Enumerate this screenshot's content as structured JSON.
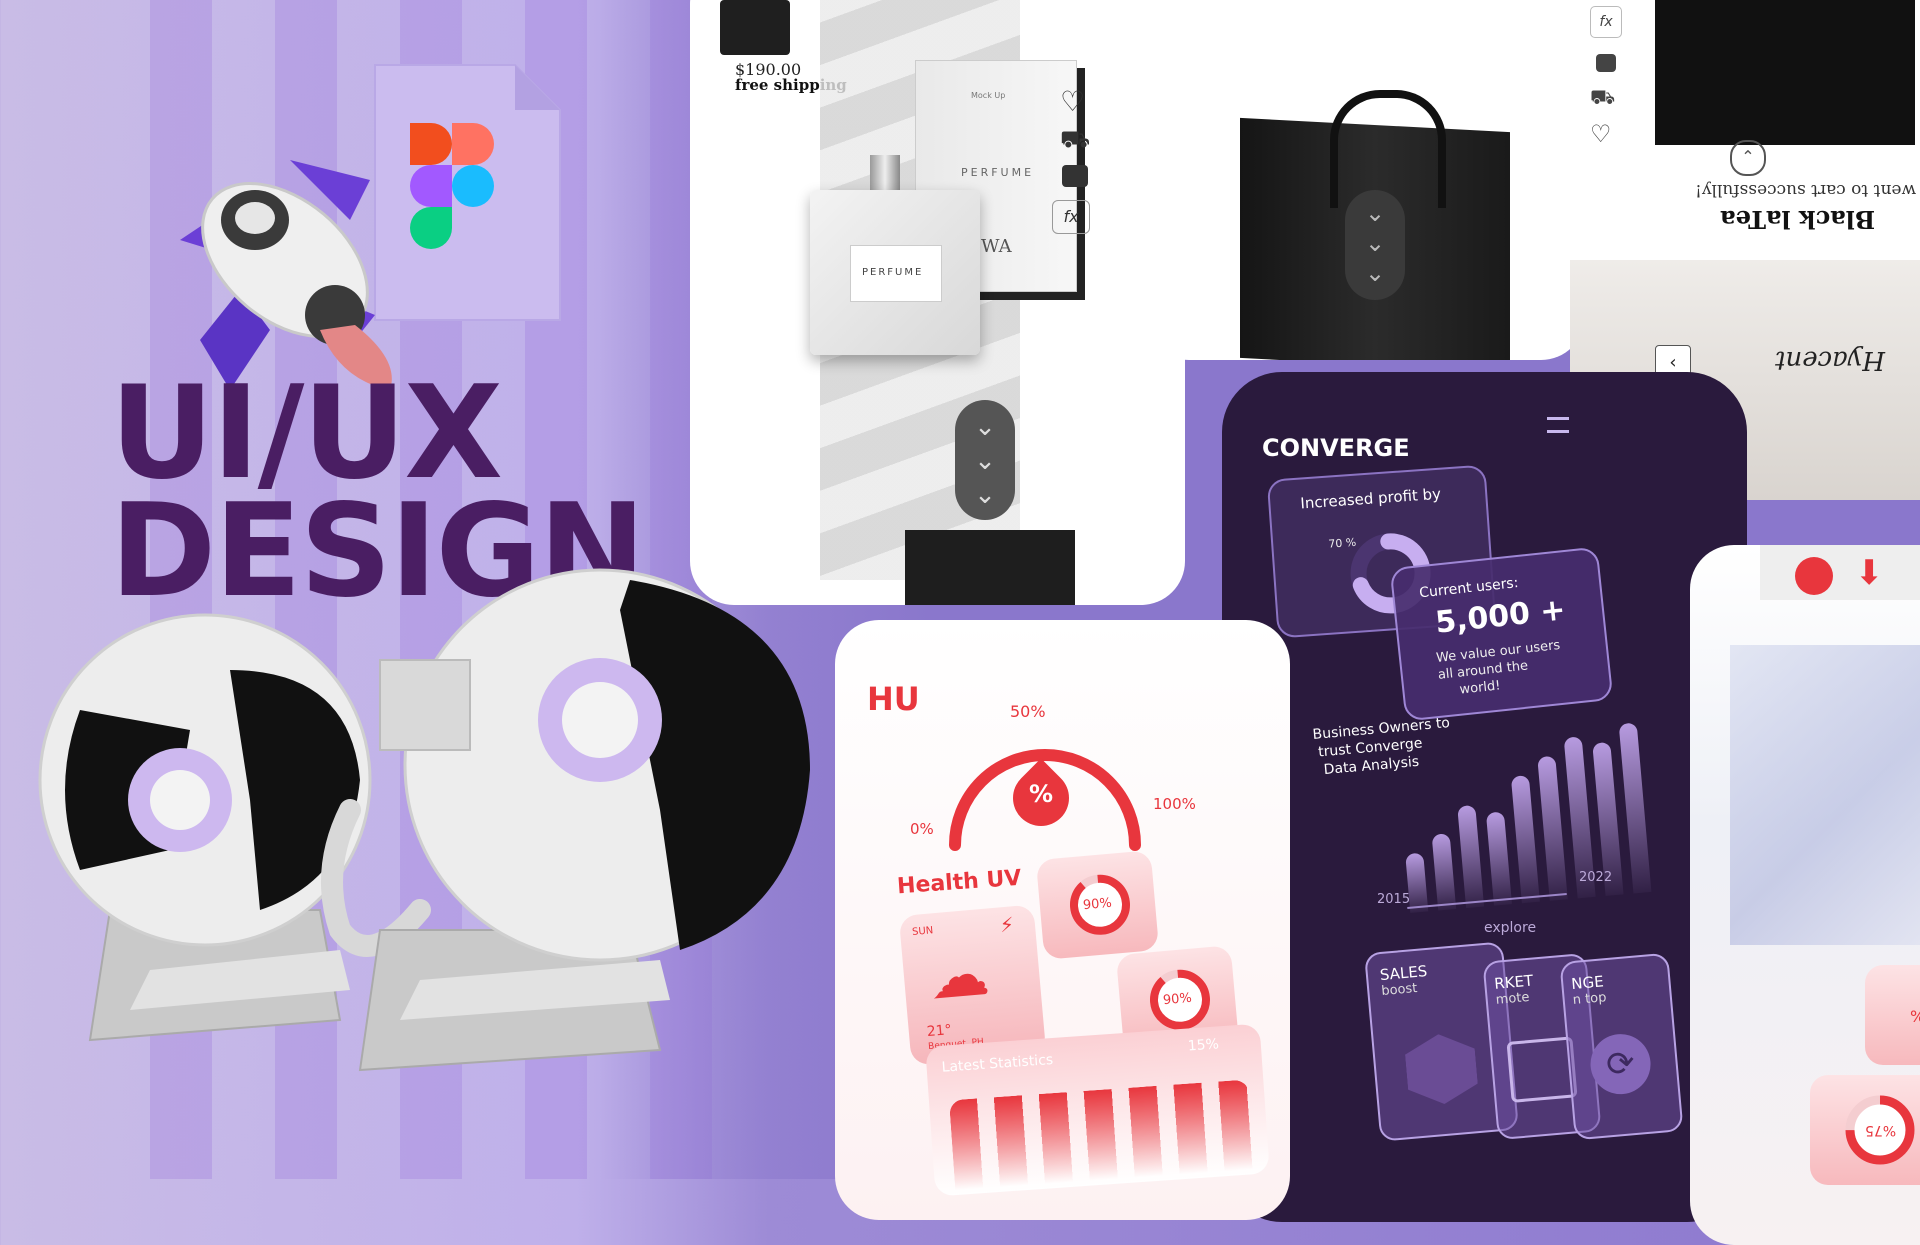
{
  "hero": {
    "title_line1": "UI/UX",
    "title_line2": "DESIGN",
    "title_color": "#4a1e63"
  },
  "perfume_card": {
    "price": "$190.00",
    "shipping": "free shipping",
    "box_label": "PERFUME",
    "bottle_label": "PERFUME",
    "box_brand": "WA",
    "mockup_label": "Mock Up"
  },
  "cart_card": {
    "message": "went to cart successfully!",
    "product_name": "Black laTea",
    "script_word": "Hyacent"
  },
  "converge_card": {
    "brand": "CONVERGE",
    "profit_label": "Increased profit by",
    "profit_percent_label": "70 %",
    "profit_fraction": 0.7,
    "users_label": "Current users:",
    "users_value": "5,000 +",
    "users_note_line1": "We value our users",
    "users_note_line2": "all around the",
    "users_note_line3": "world!",
    "trust_line1": "Business Owners to",
    "trust_line2": "trust Converge",
    "trust_line3": "Data Analysis",
    "bar_heights": [
      0.35,
      0.45,
      0.6,
      0.55,
      0.75,
      0.85,
      0.95,
      0.9,
      1.0
    ],
    "axis_start": "2015",
    "axis_end": "2022",
    "explore": "explore",
    "tile1_title": "SALES",
    "tile1_sub": "boost",
    "tile2_title": "RKET",
    "tile2_sub": "mote",
    "tile3_title": "NGE",
    "tile3_sub": "n top",
    "accent": "#b79be0"
  },
  "health_card": {
    "brand": "HU",
    "gauge_top": "50%",
    "gauge_min": "0%",
    "gauge_max": "100%",
    "section_title": "Health UV",
    "ring1_label": "90%",
    "ring1_fraction": 0.9,
    "ring2_label": "90%",
    "ring2_fraction": 0.9,
    "weather_day": "SUN",
    "weather_temp": "21°",
    "weather_place": "Benguet, PH",
    "stats_title": "Latest Statistics",
    "stats_percent": "15%",
    "accent": "#e8363d"
  },
  "right_card": {
    "ring_label": "%",
    "ring2_label": "%75"
  }
}
